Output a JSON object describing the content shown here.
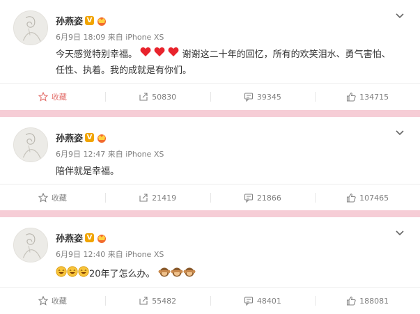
{
  "posts": [
    {
      "user": "孙燕姿",
      "verified_badge": "V",
      "time": "6月9日 18:09",
      "source": "来自 iPhone XS",
      "text_before": "今天感觉特别幸福。",
      "hearts": 3,
      "text_after": "谢谢这二十年的回忆，所有的欢笑泪水、勇气害怕、任性、执着。我的成就是有你们。",
      "actions": {
        "favorite": "收藏",
        "repost": "50830",
        "comment": "39345",
        "like": "134715"
      },
      "favorite_active": true
    },
    {
      "user": "孙燕姿",
      "verified_badge": "V",
      "time": "6月9日 12:47",
      "source": "来自 iPhone XS",
      "text_before": "陪伴就是幸福。",
      "actions": {
        "favorite": "收藏",
        "repost": "21419",
        "comment": "21866",
        "like": "107465"
      },
      "favorite_active": false
    },
    {
      "user": "孙燕姿",
      "verified_badge": "V",
      "time": "6月9日 12:40",
      "source": "来自 iPhone XS",
      "text_before": "20年了怎么办。",
      "actions": {
        "favorite": "收藏",
        "repost": "55482",
        "comment": "48401",
        "like": "188081"
      },
      "favorite_active": false
    }
  ],
  "colors": {
    "background": "#f6cdd6",
    "heart": "#e8232c",
    "fav_active": "#e36e6a"
  },
  "icons": [
    "chevron-down-icon",
    "star-icon",
    "repost-icon",
    "comment-icon",
    "like-icon",
    "heart-emoji",
    "grin-emoji",
    "monkey-emoji"
  ]
}
